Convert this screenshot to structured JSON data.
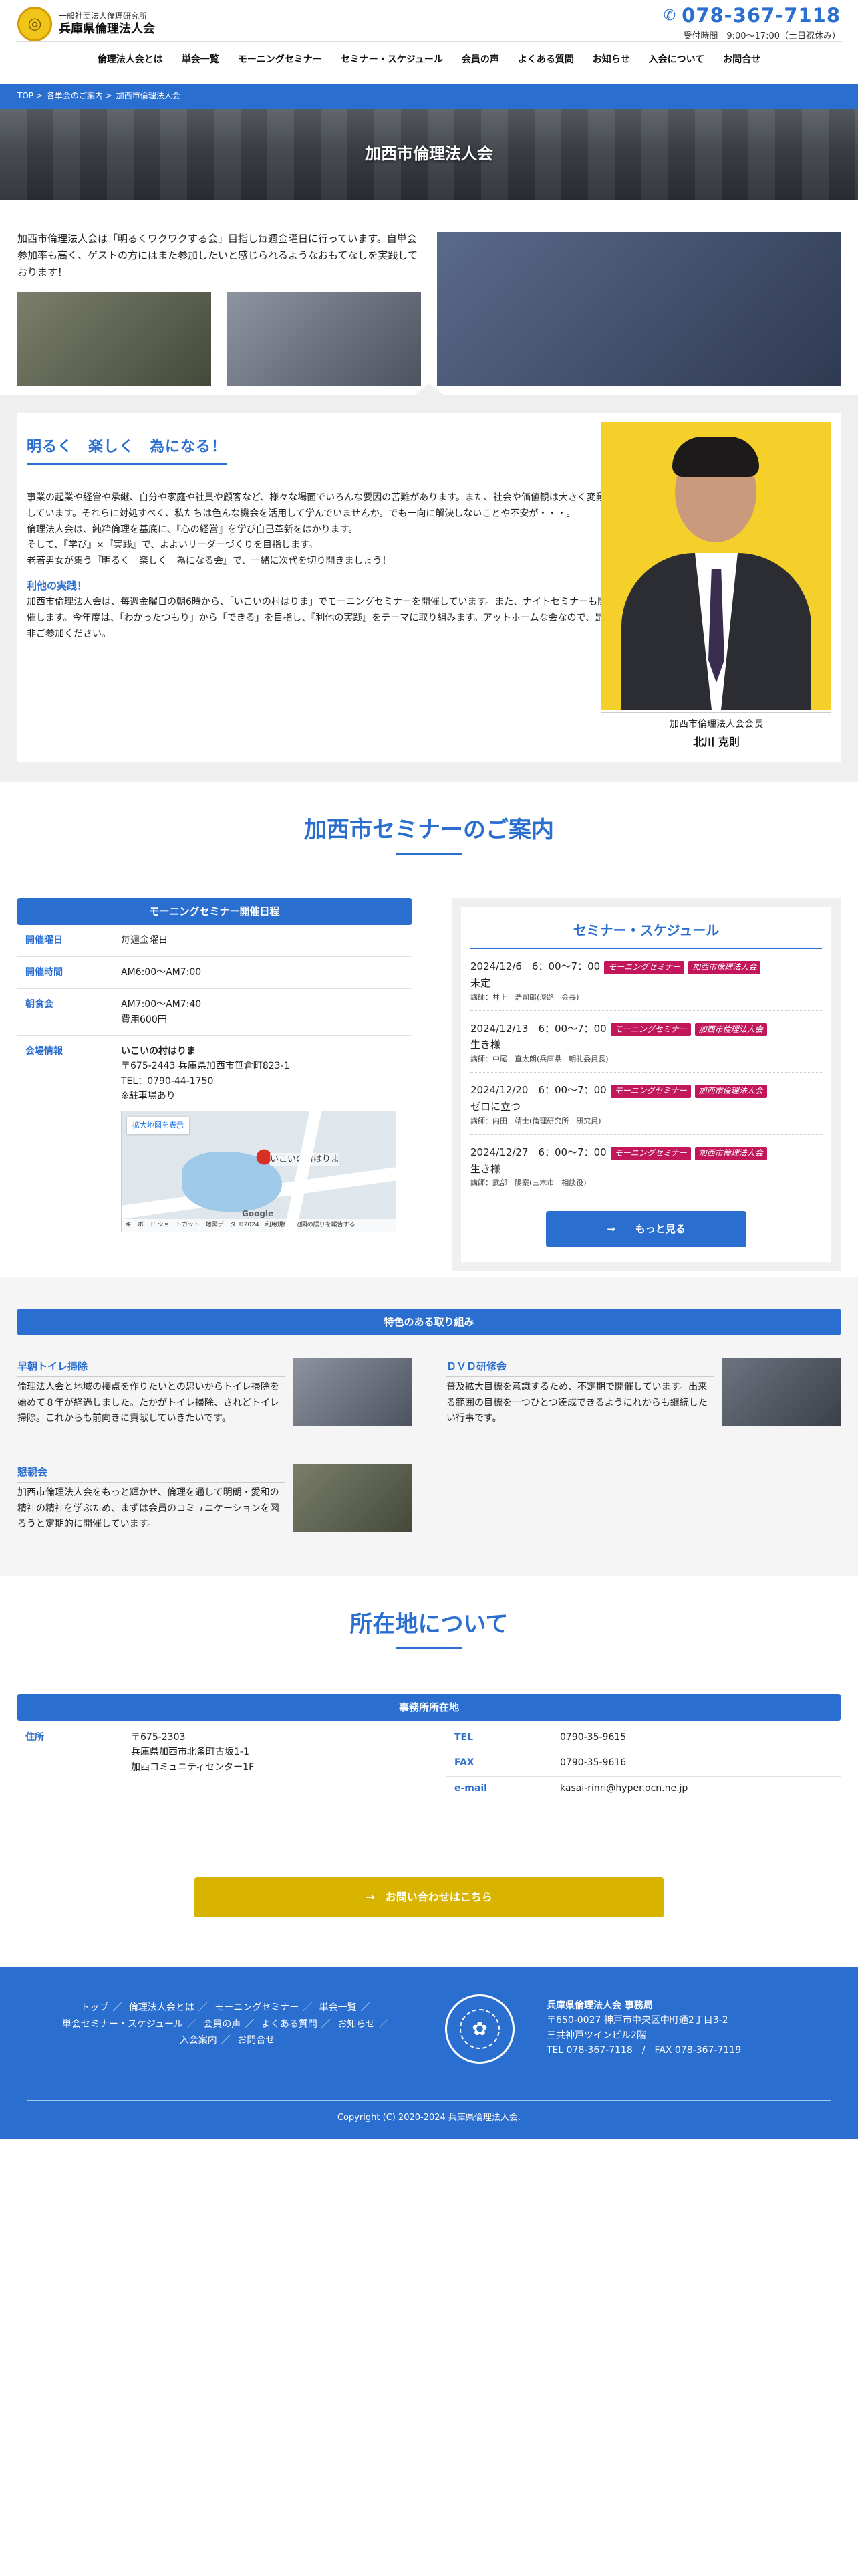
{
  "header": {
    "logo_sub": "一般社団法人倫理研究所",
    "logo_main": "兵庫県倫理法人会",
    "phone": "078-367-7118",
    "hours": "受付時間　9:00〜17:00（土日祝休み）",
    "nav": [
      "倫理法人会とは",
      "単会一覧",
      "モーニングセミナー",
      "セミナー・スケジュール",
      "会員の声",
      "よくある質問",
      "お知らせ",
      "入会について",
      "お問合せ"
    ]
  },
  "breadcrumb": [
    "TOP >",
    "各単会のご案内 >",
    "加西市倫理法人会"
  ],
  "hero": {
    "title": "加西市倫理法人会"
  },
  "intro": {
    "text": "加西市倫理法人会は「明るくワクワクする会」目指し毎週金曜日に行っています。自単会参加率も高く、ゲストの方にはまた参加したいと感じられるようなおもてなしを実践しております！"
  },
  "message": {
    "title": "明るく　楽しく　為になる！",
    "p1": "事業の起業や経営や承継、自分や家庭や社員や顧客など、様々な場面でいろんな要因の苦難があります。また、社会や価値観は大きく変動しています。それらに対処すべく、私たちは色んな機会を活用して学んでいませんか。でも一向に解決しないことや不安が・・・。",
    "p2": "倫理法人会は、純粋倫理を基底に、『心の経営』を学び自己革新をはかります。",
    "p3": "そして、『学び』×『実践』で、よよいリーダーづくりを目指します。",
    "p4": "老若男女が集う『明るく　楽しく　為になる会』で、一緒に次代を切り開きましょう！",
    "sub": "利他の実践！",
    "p5": "加西市倫理法人会は、毎週金曜日の朝6時から、「いこいの村はりま」でモーニングセミナーを開催しています。また、ナイトセミナーも開催します。今年度は、「わかったつもり」から「できる」を目指し、『利他の実践』をテーマに取り組みます。アットホームな会なので、是非ご参加ください。",
    "role": "加西市倫理法人会会長",
    "name": "北川 克則"
  },
  "seminar": {
    "title": "加西市セミナーのご案内",
    "info_head": "モーニングセミナー開催日程",
    "rows": [
      {
        "label": "開催曜日",
        "lines": [
          "毎週金曜日"
        ]
      },
      {
        "label": "開催時間",
        "lines": [
          "AM6:00〜AM7:00"
        ]
      },
      {
        "label": "朝食会",
        "lines": [
          "AM7:00〜AM7:40",
          "費用600円"
        ]
      }
    ],
    "venue_label": "会場情報",
    "venue_name": "いこいの村はりま",
    "venue_addr": "〒675-2443 兵庫県加西市笹倉町823-1",
    "venue_tel": "TEL：0790-44-1750",
    "venue_park": "※駐車場あり",
    "map_link": "拡大地図を表示",
    "map_place": "いこいの村はりま",
    "map_google": "Google",
    "map_credit": "キーボード ショートカット　地図データ ©2024　利用規約　地図の誤りを報告する",
    "sched_title": "セミナー・スケジュール",
    "tag1": "モーニングセミナー",
    "tag2": "加西市倫理法人会",
    "schedule": [
      {
        "date": "2024/12/6　6：00〜7：00",
        "topic": "未定",
        "speaker": "講師：井上　浩司郎(淡路　会長)"
      },
      {
        "date": "2024/12/13　6：00〜7：00",
        "topic": "生き様",
        "speaker": "講師：中尾　直太朗(兵庫県　朝礼委員長)"
      },
      {
        "date": "2024/12/20　6：00〜7：00",
        "topic": "ゼロに立つ",
        "speaker": "講師：内田　靖士(倫理研究所　研究員)"
      },
      {
        "date": "2024/12/27　6：00〜7：00",
        "topic": "生き様",
        "speaker": "講師：武部　陽案(三木市　相談役)"
      }
    ],
    "more": "→　　もっと見る"
  },
  "features": {
    "head": "特色のある取り組み",
    "items": [
      {
        "title": "早朝トイレ掃除",
        "text": "倫理法人会と地域の接点を作りたいとの思いからトイレ掃除を始めて８年が経過しました。たかがトイレ掃除、されどトイレ掃除。これからも前向きに貢献していきたいです。"
      },
      {
        "title": "ＤＶＤ研修会",
        "text": "普及拡大目標を意識するため、不定期で開催しています。出来る範囲の目標を一つひとつ達成できるようにれからも継続したい行事です。"
      },
      {
        "title": "懇親会",
        "text": "加西市倫理法人会をもっと輝かせ、倫理を通して明朗・愛和の精神の精神を学ぶため、まずは会員のコミュニケーションを図ろうと定期的に開催しています。"
      }
    ]
  },
  "location": {
    "title": "所在地について",
    "head": "事務所所在地",
    "addr_label": "住所",
    "addr_lines": [
      "〒675-2303",
      "兵庫県加西市北条町古坂1-1",
      "加西コミュニティセンター1F"
    ],
    "tel_label": "TEL",
    "tel": "0790-35-9615",
    "fax_label": "FAX",
    "fax": "0790-35-9616",
    "mail_label": "e-mail",
    "mail": "kasai-rinri@hyper.ocn.ne.jp",
    "contact_btn": "→　お問い合わせはこちら"
  },
  "footer": {
    "nav": [
      "トップ",
      "倫理法人会とは",
      "モーニングセミナー",
      "単会一覧",
      "単会セミナー・スケジュール",
      "会員の声",
      "よくある質問",
      "お知らせ",
      "入会案内",
      "お問合せ"
    ],
    "office_name": "兵庫県倫理法人会 事務局",
    "office_addr1": "〒650-0027 神戸市中央区中町通2丁目3-2",
    "office_addr2": "三共神戸ツインビル2階",
    "office_tel": "TEL 078-367-7118　/　FAX 078-367-7119",
    "copyright": "Copyright (C) 2020-2024 兵庫県倫理法人会."
  },
  "colors": {
    "primary": "#2a6ed0",
    "accent": "#c2185b",
    "cta": "#d8b400"
  },
  "icons": {
    "phone": "phone-icon",
    "map_pin": "map-pin-icon",
    "emblem": "emblem-icon"
  }
}
